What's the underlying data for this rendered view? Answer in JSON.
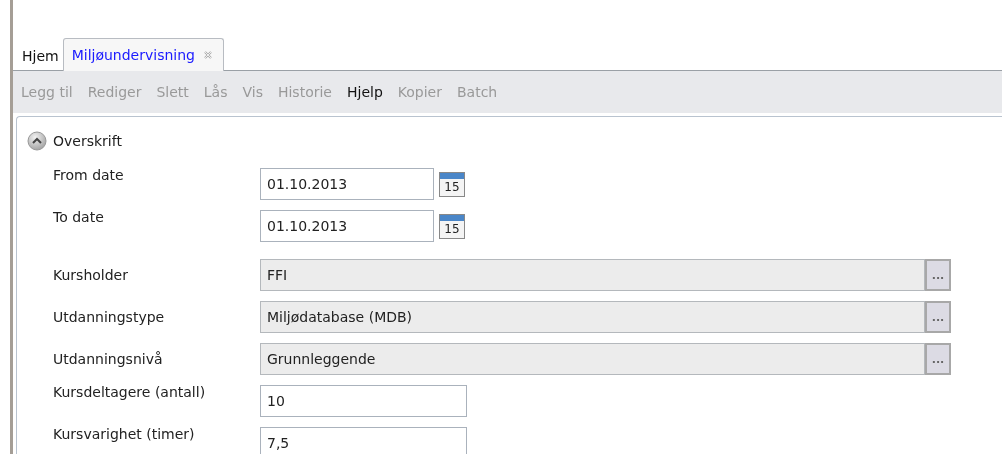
{
  "tabs": [
    {
      "label": "Hjem",
      "selected": false,
      "closable": false
    },
    {
      "label": "Miljøundervisning",
      "selected": true,
      "closable": true
    }
  ],
  "toolbar": [
    {
      "label": "Legg til",
      "disabled": true
    },
    {
      "label": "Rediger",
      "disabled": true
    },
    {
      "label": "Slett",
      "disabled": true
    },
    {
      "label": "Lås",
      "disabled": true
    },
    {
      "label": "Vis",
      "disabled": true
    },
    {
      "label": "Historie",
      "disabled": true
    },
    {
      "label": "Hjelp",
      "disabled": false
    },
    {
      "label": "Kopier",
      "disabled": true
    },
    {
      "label": "Batch",
      "disabled": true
    }
  ],
  "section": {
    "title": "Overskrift",
    "expanded": true
  },
  "fields": [
    {
      "kind": "date",
      "label": "From date",
      "value": "01.10.2013",
      "calendar_day": "15"
    },
    {
      "kind": "date",
      "label": "To date",
      "value": "01.10.2013",
      "calendar_day": "15"
    },
    {
      "kind": "lookup",
      "label": "Kursholder",
      "value": "FFI",
      "button": "..."
    },
    {
      "kind": "lookup",
      "label": "Utdanningstype",
      "value": "Miljødatabase (MDB)",
      "button": "..."
    },
    {
      "kind": "lookup",
      "label": "Utdanningsnivå",
      "value": "Grunnleggende",
      "button": "..."
    },
    {
      "kind": "text",
      "label": "Kursdeltagere (antall)",
      "value": "10"
    },
    {
      "kind": "text",
      "label": "Kursvarighet (timer)",
      "value": "7,5"
    }
  ]
}
